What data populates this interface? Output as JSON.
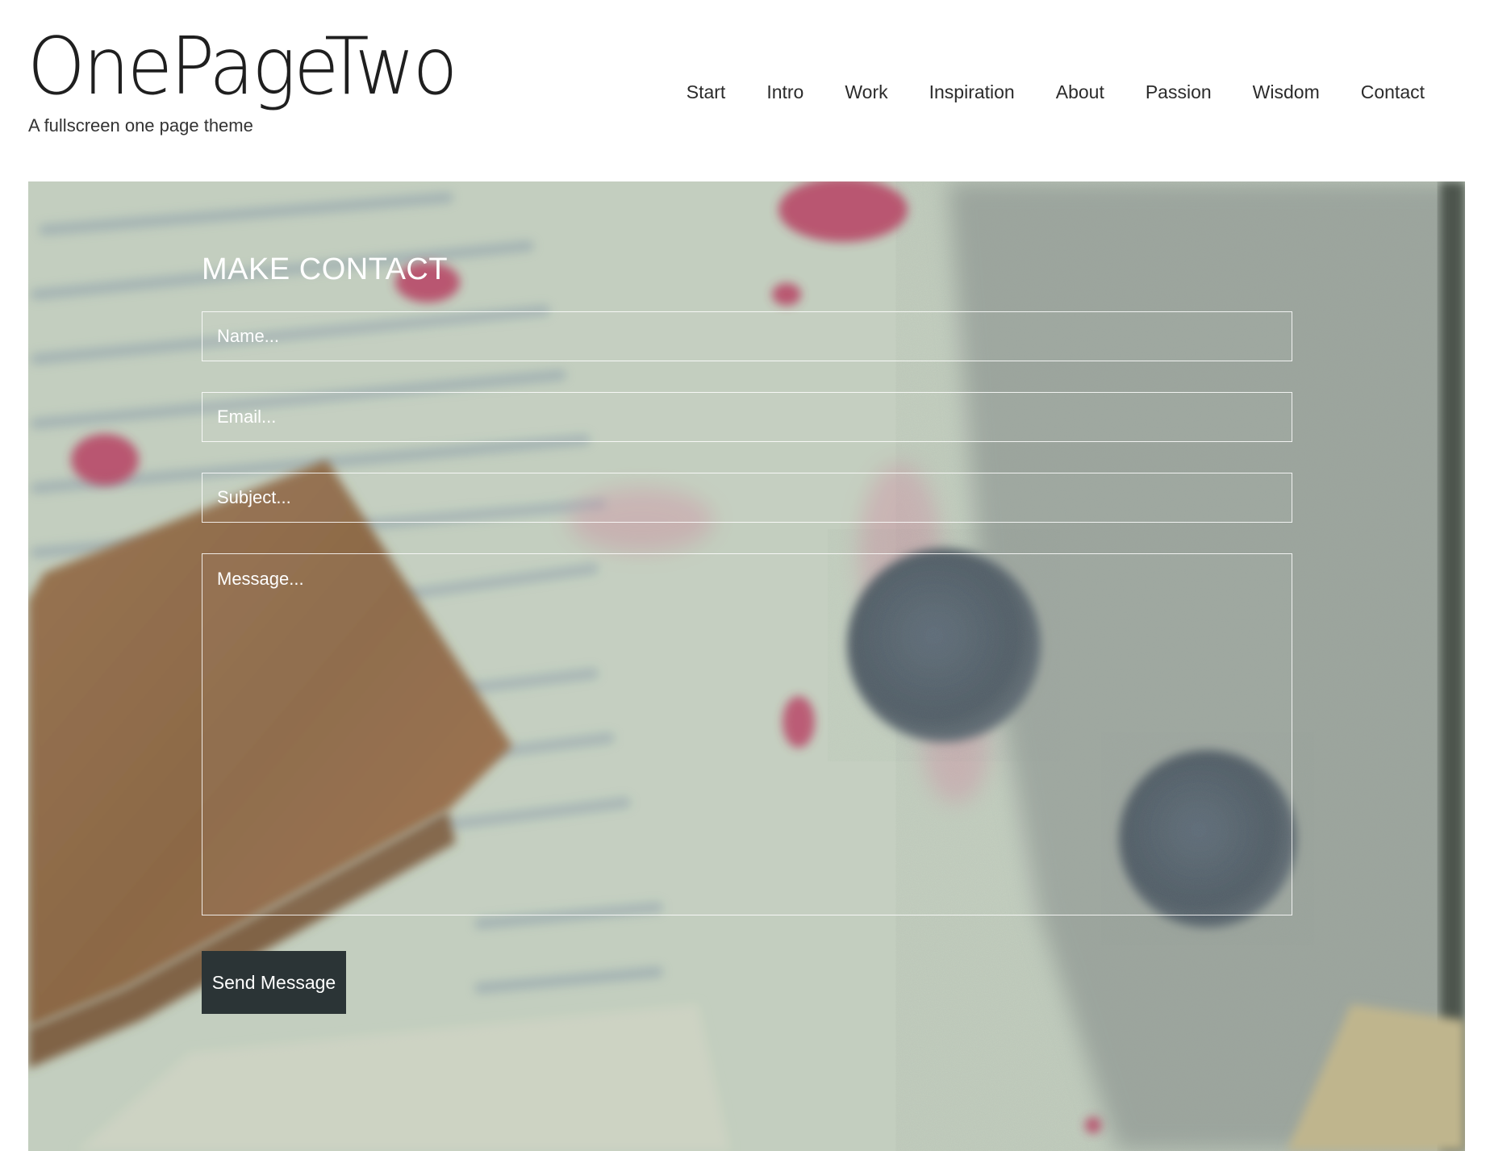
{
  "site": {
    "logo": "OnePageTwo",
    "tagline": "A fullscreen one page theme"
  },
  "nav": {
    "items": [
      {
        "label": "Start"
      },
      {
        "label": "Intro"
      },
      {
        "label": "Work"
      },
      {
        "label": "Inspiration"
      },
      {
        "label": "About"
      },
      {
        "label": "Passion"
      },
      {
        "label": "Wisdom"
      },
      {
        "label": "Contact"
      }
    ]
  },
  "contact": {
    "title": "MAKE CONTACT",
    "name_placeholder": "Name...",
    "email_placeholder": "Email...",
    "subject_placeholder": "Subject...",
    "message_placeholder": "Message...",
    "submit_label": "Send Message"
  },
  "colors": {
    "button_bg": "#2b3436",
    "text_on_image": "#ffffff"
  }
}
